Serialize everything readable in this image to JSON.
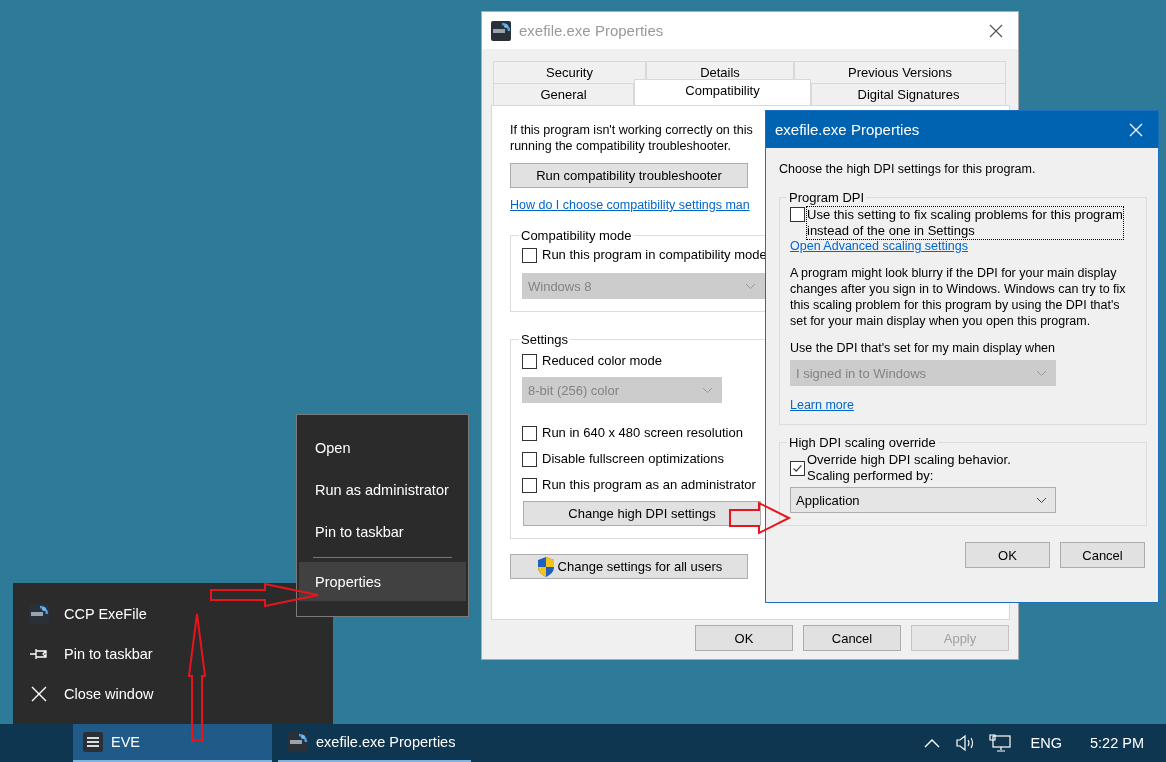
{
  "properties_window": {
    "title": "exefile.exe Properties",
    "active": false,
    "tabs_back": [
      {
        "label": "Security",
        "selected": false
      },
      {
        "label": "Details",
        "selected": false
      },
      {
        "label": "Previous Versions",
        "selected": false
      }
    ],
    "tabs_front": [
      {
        "label": "General",
        "selected": false
      },
      {
        "label": "Compatibility",
        "selected": true
      },
      {
        "label": "Digital Signatures",
        "selected": false
      }
    ],
    "intro_lines": [
      "If this program isn't working correctly on this",
      "running the compatibility troubleshooter."
    ],
    "troubleshooter_button": "Run compatibility troubleshooter",
    "help_link": "How do I choose compatibility settings man",
    "compat_group": {
      "title": "Compatibility mode",
      "checkbox": {
        "label": "Run this program in compatibility mode",
        "checked": false
      },
      "dropdown": {
        "value": "Windows 8",
        "disabled": true
      }
    },
    "settings_group": {
      "title": "Settings",
      "items": [
        {
          "kind": "checkbox",
          "label": "Reduced color mode",
          "checked": false
        },
        {
          "kind": "dropdown",
          "value": "8-bit (256) color",
          "disabled": true
        },
        {
          "kind": "checkbox",
          "label": "Run in 640 x 480 screen resolution",
          "checked": false
        },
        {
          "kind": "checkbox",
          "label": "Disable fullscreen optimizations",
          "checked": false
        },
        {
          "kind": "checkbox",
          "label": "Run this program as an administrator",
          "checked": false
        },
        {
          "kind": "button",
          "label": "Change high DPI settings"
        }
      ]
    },
    "all_users_button": "Change settings for all users",
    "buttons": [
      {
        "label": "OK",
        "disabled": false
      },
      {
        "label": "Cancel",
        "disabled": false
      },
      {
        "label": "Apply",
        "disabled": true
      }
    ]
  },
  "dpi_dialog": {
    "title": "exefile.exe Properties",
    "active": true,
    "intro": "Choose the high DPI settings for this program.",
    "program_dpi": {
      "title": "Program DPI",
      "checkbox": {
        "label_lines": [
          "Use this setting to fix scaling problems for this program",
          "instead of the one in Settings"
        ],
        "checked": false,
        "focused": true
      },
      "link": "Open Advanced scaling settings",
      "description_lines": [
        "A program might look blurry if the DPI for your main display",
        "changes after you sign in to Windows. Windows can try to fix",
        "this scaling problem for this program by using the DPI that's",
        "set for your main display when you open this program."
      ],
      "prompt": "Use the DPI that's set for my main display when",
      "dropdown": {
        "value": "I signed in to Windows",
        "disabled": true
      },
      "learn_more": "Learn more"
    },
    "override": {
      "title": "High DPI scaling override",
      "checkbox": {
        "label_lines": [
          "Override high DPI scaling behavior.",
          "Scaling performed by:"
        ],
        "checked": true,
        "focused": false
      },
      "dropdown": {
        "value": "Application",
        "disabled": false
      }
    },
    "buttons": [
      {
        "label": "OK",
        "disabled": false
      },
      {
        "label": "Cancel",
        "disabled": false
      }
    ]
  },
  "context_menu": {
    "items": [
      {
        "kind": "item",
        "label": "Open",
        "selected": false
      },
      {
        "kind": "item",
        "label": "Run as administrator",
        "selected": false
      },
      {
        "kind": "item",
        "label": "Pin to taskbar",
        "selected": false
      },
      {
        "kind": "separator"
      },
      {
        "kind": "item",
        "label": "Properties",
        "selected": true
      }
    ]
  },
  "jump_list": {
    "items": [
      {
        "kind": "app",
        "label": "CCP ExeFile"
      },
      {
        "kind": "pin",
        "label": "Pin to taskbar"
      },
      {
        "kind": "close",
        "label": "Close window"
      }
    ]
  },
  "taskbar": {
    "buttons": [
      {
        "kind": "menu",
        "label": "EVE",
        "selected": true
      },
      {
        "kind": "app",
        "label": "exefile.exe Properties",
        "selected": false
      }
    ],
    "language": "ENG",
    "time": "5:22 PM"
  }
}
